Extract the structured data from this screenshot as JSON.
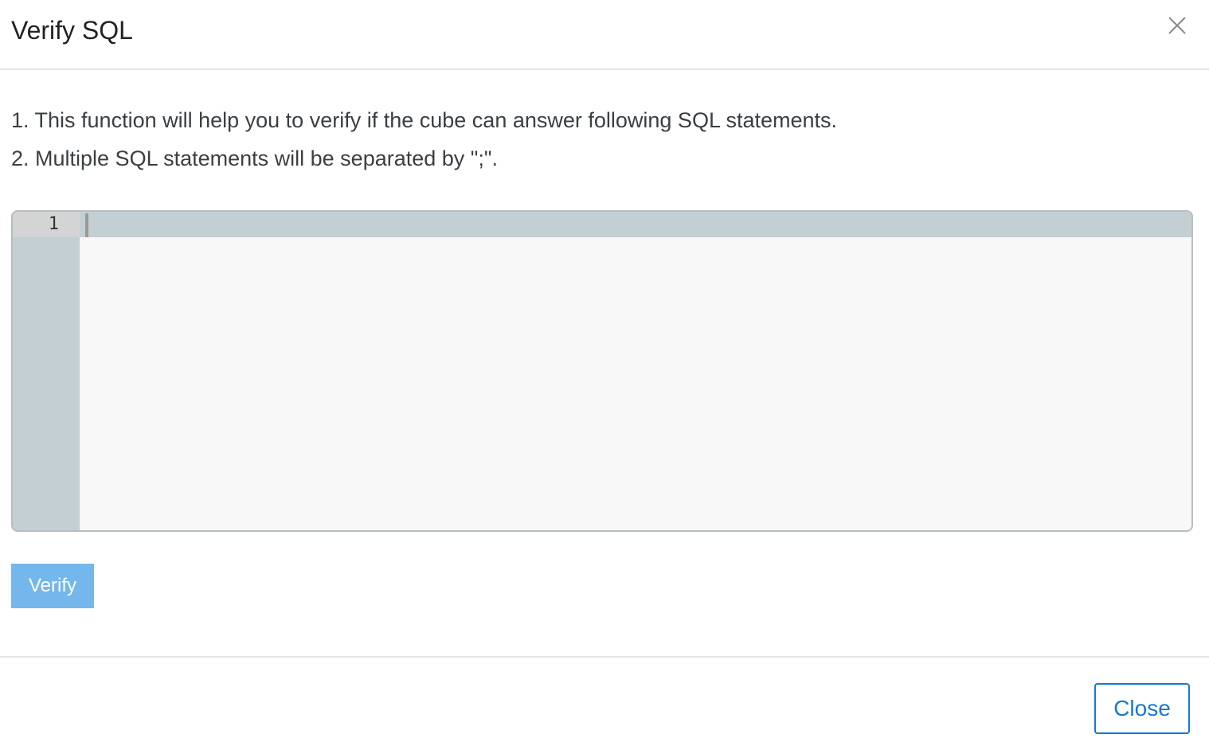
{
  "dialog": {
    "title": "Verify SQL",
    "close_icon": "close-icon"
  },
  "instructions": [
    "1. This function will help you to verify if the cube can answer following SQL statements.",
    "2. Multiple SQL statements will be separated by \";\"."
  ],
  "editor": {
    "line_numbers": [
      "1"
    ],
    "content": ""
  },
  "buttons": {
    "verify": "Verify",
    "close": "Close"
  },
  "colors": {
    "primary": "#1479d2",
    "verify_disabled": "#73b7ec"
  }
}
